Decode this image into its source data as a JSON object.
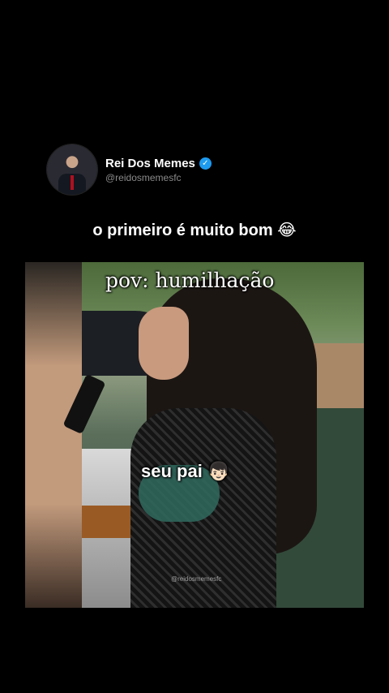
{
  "author": {
    "display_name": "Rei Dos Memes",
    "handle": "@reidosmemesfc",
    "verified_icon": "verified-badge-icon",
    "verified_glyph": "✓",
    "badge_color": "#1d9bf0"
  },
  "post": {
    "caption": "o primeiro é muito bom",
    "caption_emoji": "😂"
  },
  "video": {
    "overlay_top": "pov: humilhação",
    "overlay_middle": "seu pai",
    "overlay_middle_emoji": "👦🏻",
    "watermark": "@reidosmemesfc"
  }
}
